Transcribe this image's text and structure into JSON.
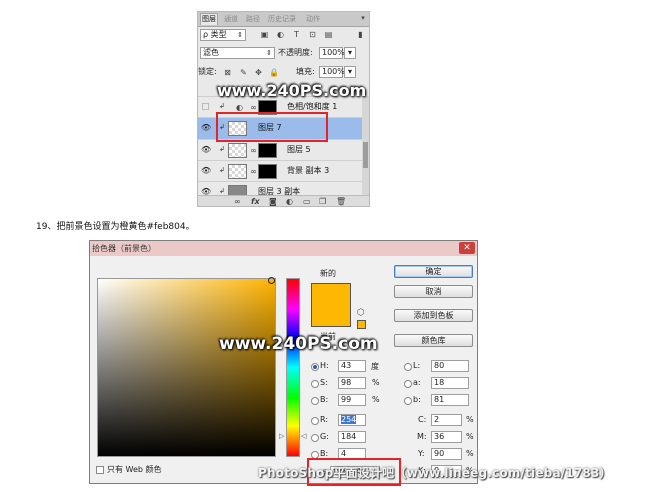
{
  "layers_panel": {
    "tabs": [
      "图层",
      "通道",
      "路径",
      "历史记录",
      "动作"
    ],
    "filter_label": "ρ 类型",
    "blend_mode": "滤色",
    "opacity_label": "不透明度:",
    "opacity_value": "100%",
    "lock_label": "锁定:",
    "fill_label": "填充:",
    "fill_value": "100%",
    "layers": [
      {
        "name": "色相/饱和度 1",
        "visible": false,
        "selected": false
      },
      {
        "name": "图层 7",
        "visible": true,
        "selected": true
      },
      {
        "name": "图层 5",
        "visible": true,
        "selected": false
      },
      {
        "name": "背景 副本 3",
        "visible": true,
        "selected": false
      },
      {
        "name": "图层 3 副本",
        "visible": true,
        "selected": false
      }
    ],
    "bottom_icons": [
      "link-icon",
      "fx-icon",
      "mask-icon",
      "adjustment-icon",
      "folder-icon",
      "new-layer-icon",
      "trash-icon"
    ]
  },
  "watermarks": {
    "top": "www.240PS.com",
    "middle": "www.240PS.com",
    "bottom": "PhotoShop平面设计吧（www.lineeg.com/tieba/1783）"
  },
  "caption": "19、把前景色设置为橙黄色#feb804。",
  "color_picker": {
    "title": "拾色器（前景色）",
    "close": "✕",
    "new_label": "新的",
    "current_label": "当前",
    "buttons": {
      "ok": "确定",
      "cancel": "取消",
      "add_swatch": "添加到色板",
      "libraries": "颜色库"
    },
    "hsb": {
      "h_label": "H:",
      "h_value": "43",
      "h_unit": "度",
      "s_label": "S:",
      "s_value": "98",
      "s_unit": "%",
      "b_label": "B:",
      "b_value": "99",
      "b_unit": "%"
    },
    "rgb": {
      "r_label": "R:",
      "r_value": "254",
      "g_label": "G:",
      "g_value": "184",
      "b_label": "B:",
      "b_value": "4"
    },
    "lab": {
      "l_label": "L:",
      "l_value": "80",
      "a_label": "a:",
      "a_value": "18",
      "b_label": "b:",
      "b_value": "81"
    },
    "cmyk": {
      "c_label": "C:",
      "c_value": "2",
      "c_unit": "%",
      "m_label": "M:",
      "m_value": "36",
      "m_unit": "%",
      "y_label": "Y:",
      "y_value": "90",
      "y_unit": "%",
      "k_label": "K:",
      "k_value": "0",
      "k_unit": "%"
    },
    "hex_label": "#",
    "hex_value": "feb804",
    "web_only_label": "只有 Web 颜色",
    "selected_color": "#feb804"
  }
}
